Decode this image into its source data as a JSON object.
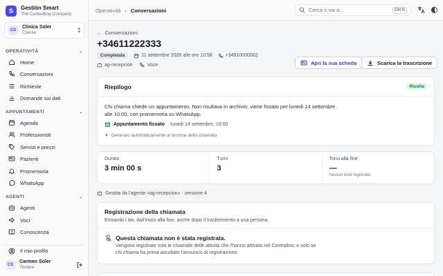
{
  "app": {
    "name": "Gestión Smart",
    "subtitle": "The Consulting Company",
    "logo_letter": "S"
  },
  "tenant": {
    "initials": "CS",
    "name": "Clinica Soler",
    "role": "Cliente"
  },
  "sidebar": {
    "sections": [
      {
        "title": "OPERATIVITÀ",
        "items": [
          {
            "label": "Home",
            "icon": "home-icon"
          },
          {
            "label": "Conversazioni",
            "icon": "phone-icon"
          },
          {
            "label": "Richieste",
            "icon": "list-icon"
          },
          {
            "label": "Domande sui dati",
            "icon": "chart-icon"
          }
        ]
      },
      {
        "title": "APPUNTAMENTI",
        "items": [
          {
            "label": "Agenda",
            "icon": "calendar-icon"
          },
          {
            "label": "Professionisti",
            "icon": "users-icon"
          },
          {
            "label": "Servizi e prezzi",
            "icon": "tag-icon"
          },
          {
            "label": "Pazienti",
            "icon": "id-card-icon"
          },
          {
            "label": "Promemoria",
            "icon": "bell-icon"
          },
          {
            "label": "WhatsApp",
            "icon": "whatsapp-icon"
          }
        ]
      },
      {
        "title": "AGENTI",
        "items": [
          {
            "label": "Agenti",
            "icon": "bot-icon"
          },
          {
            "label": "Voci",
            "icon": "speaker-icon"
          },
          {
            "label": "Conoscenza",
            "icon": "book-icon"
          }
        ]
      }
    ],
    "profile_label": "Il mio profilo"
  },
  "user": {
    "initials": "CS",
    "name": "Carmen Soler",
    "role": "Titolare"
  },
  "topbar": {
    "breadcrumb": [
      "Operatività",
      "Conversazioni"
    ],
    "search_placeholder": "Cerca o vai a...",
    "shortcut": "Ctrl K"
  },
  "conversation": {
    "back_label": "Conversazioni",
    "phone": "+34611222333",
    "status": "Completata",
    "datetime": "11 settembre 2026 alle ore 10:58",
    "called_number": "+34910000002",
    "agent": "ag-recepcion",
    "channel": "Voce",
    "actions": {
      "open_card": "Apri la sua scheda",
      "download": "Scarica la trascrizione"
    }
  },
  "summary": {
    "title": "Riepilogo",
    "badge": "Risolta",
    "text": "Chi chiama chiede un appuntamento. Non risultava in archivio; viene fissato per lunedì 14 settembre alle 10:00, con promemoria su WhatsApp.",
    "appointment_label": "Appuntamento fissato",
    "appointment_when": "· lunedì 14 settembre, 10:00",
    "generated_note": "Generato automaticamente al termine della chiamata"
  },
  "stats": [
    {
      "label": "Durata",
      "value": "3 min 00 s",
      "sub": ""
    },
    {
      "label": "Turni",
      "value": "3",
      "sub": ""
    },
    {
      "label": "Tono alla fine",
      "value": "—",
      "sub": "nessun tono registrato"
    }
  ],
  "agent_line": "Gestita da l'agente «ag-recepcion» · versione 4",
  "recording": {
    "title": "Registrazione della chiamata",
    "subtitle": "Entrambi i lati, dall'inizio alla fine, anche dopo il trasferimento a una persona.",
    "notice_title": "Questa chiamata non è stata registrata.",
    "notice_text": "Vengono registrate solo le chiamate delle attività che l'hanno attivato nel Centralino, e solo se chi chiama ha prima ascoltato l'annuncio di registrazione."
  },
  "colors": {
    "accent": "#4f46e5",
    "success_bg": "#dcfce7",
    "success_fg": "#15803d"
  }
}
